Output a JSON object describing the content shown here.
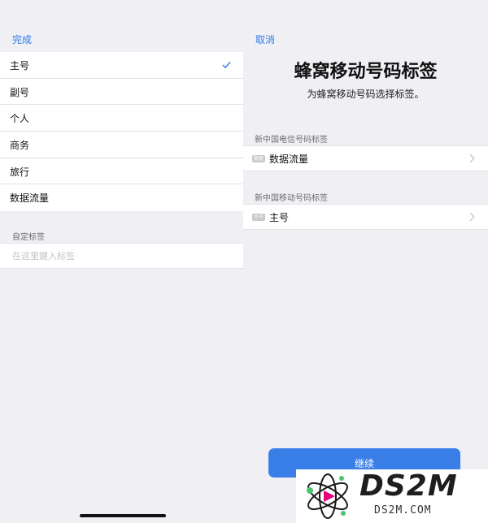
{
  "left_panel": {
    "done_label": "完成",
    "labels": [
      {
        "text": "主号",
        "selected": true
      },
      {
        "text": "副号",
        "selected": false
      },
      {
        "text": "个人",
        "selected": false
      },
      {
        "text": "商务",
        "selected": false
      },
      {
        "text": "旅行",
        "selected": false
      },
      {
        "text": "数据流量",
        "selected": false
      }
    ],
    "custom_label_header": "自定标签",
    "custom_label_placeholder": "在这里键入标签"
  },
  "right_panel": {
    "cancel_label": "取消",
    "title": "蜂窝移动号码标签",
    "subtitle": "为蜂窝移动号码选择标签。",
    "lines": [
      {
        "section_header": "新中国电信号码标签",
        "badge": "数据",
        "label": "数据流量"
      },
      {
        "section_header": "新中国移动号码标签",
        "badge": "主号",
        "label": "主号"
      }
    ],
    "continue_label": "继续"
  },
  "watermark": {
    "brand": "DS2M",
    "url": "DS2M.COM"
  },
  "colors": {
    "accent": "#2f7bea",
    "button": "#3a7ee8",
    "background": "#efeff4",
    "separator": "#e2e2e6"
  },
  "icons": {
    "selected_marker": "checkmark-icon",
    "row_disclosure": "chevron-right-icon",
    "watermark_logo": "atom-logo-icon"
  }
}
